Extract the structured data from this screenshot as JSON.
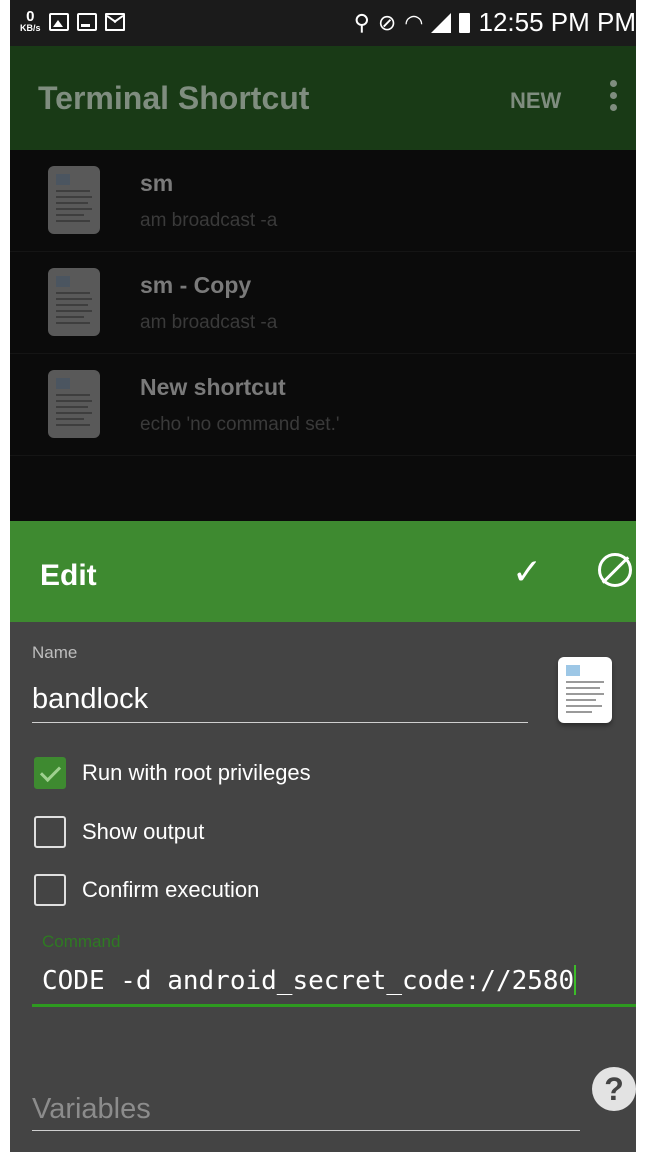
{
  "status_bar": {
    "kbs_value": "0",
    "kbs_unit": "KB/s",
    "time": "12:55 PM PM",
    "icons": [
      "gallery-icon",
      "terminal-icon",
      "mail-icon",
      "location-icon",
      "mute-icon",
      "wifi-icon",
      "signal-icon",
      "battery-icon"
    ]
  },
  "appbar": {
    "title": "Terminal Shortcut",
    "new_label": "NEW"
  },
  "shortcuts": [
    {
      "name": "sm",
      "command": "am broadcast -a"
    },
    {
      "name": "sm - Copy",
      "command": "am broadcast -a"
    },
    {
      "name": "New shortcut",
      "command": "echo 'no command set.'"
    }
  ],
  "edit_dialog": {
    "title": "Edit",
    "name_label": "Name",
    "name_value": "bandlock",
    "run_root_label": "Run with root privileges",
    "run_root_checked": true,
    "show_output_label": "Show output",
    "show_output_checked": false,
    "confirm_label": "Confirm execution",
    "confirm_checked": false,
    "command_label": "Command",
    "command_value": "CODE -d android_secret_code://2580",
    "variables_placeholder": "Variables",
    "help_label": "?"
  },
  "colors": {
    "accent": "#3e8a30",
    "dialog_bg": "#444444",
    "command_underline": "#2e9a20"
  }
}
